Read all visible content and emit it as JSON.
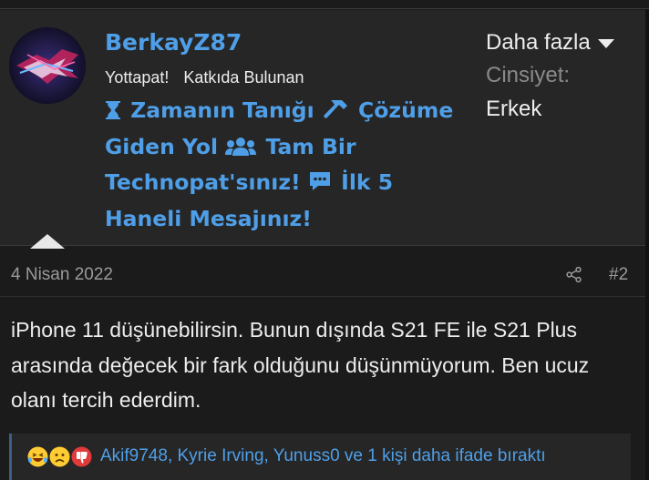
{
  "user": {
    "username": "BerkayZ87",
    "title": "Yottapat!",
    "banner": "Katkıda Bulunan",
    "trophies": [
      {
        "icon": "hourglass-icon",
        "label": "Zamanın Tanığı"
      },
      {
        "icon": "hammer-icon",
        "label": "Çözüme Giden Yol"
      },
      {
        "icon": "users-icon",
        "label": "Tam Bir Technopat'sınız!"
      },
      {
        "icon": "comment-icon",
        "label": "İlk 5 Haneli Mesajınız!"
      }
    ],
    "extras": {
      "more_label": "Daha fazla",
      "gender_label": "Cinsiyet:",
      "gender_value": "Erkek"
    }
  },
  "post": {
    "date": "4 Nisan 2022",
    "number": "#2",
    "body": "iPhone 11 düşünebilirsin. Bunun dışında S21 FE ile S21 Plus arasında değecek bir fark olduğunu düşünmüyorum. Ben ucuz olanı tercih ederdim."
  },
  "reactions": {
    "icons": [
      "laugh-react-icon",
      "sad-react-icon",
      "dislike-react-icon"
    ],
    "text": "Akif9748, Kyrie Irving, Yunuss0 ve 1 kişi daha ifade bıraktı"
  },
  "colors": {
    "accent": "#4f9fe8",
    "background": "#1b1b1b",
    "panel": "#262626",
    "muted": "#9a9a9a"
  }
}
